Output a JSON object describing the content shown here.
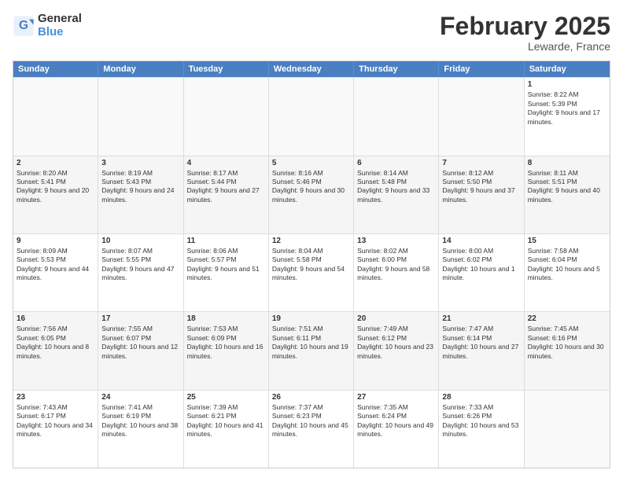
{
  "logo": {
    "general": "General",
    "blue": "Blue"
  },
  "title": "February 2025",
  "location": "Lewarde, France",
  "days_of_week": [
    "Sunday",
    "Monday",
    "Tuesday",
    "Wednesday",
    "Thursday",
    "Friday",
    "Saturday"
  ],
  "weeks": [
    [
      {
        "day": "",
        "info": ""
      },
      {
        "day": "",
        "info": ""
      },
      {
        "day": "",
        "info": ""
      },
      {
        "day": "",
        "info": ""
      },
      {
        "day": "",
        "info": ""
      },
      {
        "day": "",
        "info": ""
      },
      {
        "day": "1",
        "info": "Sunrise: 8:22 AM\nSunset: 5:39 PM\nDaylight: 9 hours and 17 minutes."
      }
    ],
    [
      {
        "day": "2",
        "info": "Sunrise: 8:20 AM\nSunset: 5:41 PM\nDaylight: 9 hours and 20 minutes."
      },
      {
        "day": "3",
        "info": "Sunrise: 8:19 AM\nSunset: 5:43 PM\nDaylight: 9 hours and 24 minutes."
      },
      {
        "day": "4",
        "info": "Sunrise: 8:17 AM\nSunset: 5:44 PM\nDaylight: 9 hours and 27 minutes."
      },
      {
        "day": "5",
        "info": "Sunrise: 8:16 AM\nSunset: 5:46 PM\nDaylight: 9 hours and 30 minutes."
      },
      {
        "day": "6",
        "info": "Sunrise: 8:14 AM\nSunset: 5:48 PM\nDaylight: 9 hours and 33 minutes."
      },
      {
        "day": "7",
        "info": "Sunrise: 8:12 AM\nSunset: 5:50 PM\nDaylight: 9 hours and 37 minutes."
      },
      {
        "day": "8",
        "info": "Sunrise: 8:11 AM\nSunset: 5:51 PM\nDaylight: 9 hours and 40 minutes."
      }
    ],
    [
      {
        "day": "9",
        "info": "Sunrise: 8:09 AM\nSunset: 5:53 PM\nDaylight: 9 hours and 44 minutes."
      },
      {
        "day": "10",
        "info": "Sunrise: 8:07 AM\nSunset: 5:55 PM\nDaylight: 9 hours and 47 minutes."
      },
      {
        "day": "11",
        "info": "Sunrise: 8:06 AM\nSunset: 5:57 PM\nDaylight: 9 hours and 51 minutes."
      },
      {
        "day": "12",
        "info": "Sunrise: 8:04 AM\nSunset: 5:58 PM\nDaylight: 9 hours and 54 minutes."
      },
      {
        "day": "13",
        "info": "Sunrise: 8:02 AM\nSunset: 6:00 PM\nDaylight: 9 hours and 58 minutes."
      },
      {
        "day": "14",
        "info": "Sunrise: 8:00 AM\nSunset: 6:02 PM\nDaylight: 10 hours and 1 minute."
      },
      {
        "day": "15",
        "info": "Sunrise: 7:58 AM\nSunset: 6:04 PM\nDaylight: 10 hours and 5 minutes."
      }
    ],
    [
      {
        "day": "16",
        "info": "Sunrise: 7:56 AM\nSunset: 6:05 PM\nDaylight: 10 hours and 8 minutes."
      },
      {
        "day": "17",
        "info": "Sunrise: 7:55 AM\nSunset: 6:07 PM\nDaylight: 10 hours and 12 minutes."
      },
      {
        "day": "18",
        "info": "Sunrise: 7:53 AM\nSunset: 6:09 PM\nDaylight: 10 hours and 16 minutes."
      },
      {
        "day": "19",
        "info": "Sunrise: 7:51 AM\nSunset: 6:11 PM\nDaylight: 10 hours and 19 minutes."
      },
      {
        "day": "20",
        "info": "Sunrise: 7:49 AM\nSunset: 6:12 PM\nDaylight: 10 hours and 23 minutes."
      },
      {
        "day": "21",
        "info": "Sunrise: 7:47 AM\nSunset: 6:14 PM\nDaylight: 10 hours and 27 minutes."
      },
      {
        "day": "22",
        "info": "Sunrise: 7:45 AM\nSunset: 6:16 PM\nDaylight: 10 hours and 30 minutes."
      }
    ],
    [
      {
        "day": "23",
        "info": "Sunrise: 7:43 AM\nSunset: 6:17 PM\nDaylight: 10 hours and 34 minutes."
      },
      {
        "day": "24",
        "info": "Sunrise: 7:41 AM\nSunset: 6:19 PM\nDaylight: 10 hours and 38 minutes."
      },
      {
        "day": "25",
        "info": "Sunrise: 7:39 AM\nSunset: 6:21 PM\nDaylight: 10 hours and 41 minutes."
      },
      {
        "day": "26",
        "info": "Sunrise: 7:37 AM\nSunset: 6:23 PM\nDaylight: 10 hours and 45 minutes."
      },
      {
        "day": "27",
        "info": "Sunrise: 7:35 AM\nSunset: 6:24 PM\nDaylight: 10 hours and 49 minutes."
      },
      {
        "day": "28",
        "info": "Sunrise: 7:33 AM\nSunset: 6:26 PM\nDaylight: 10 hours and 53 minutes."
      },
      {
        "day": "",
        "info": ""
      }
    ]
  ]
}
